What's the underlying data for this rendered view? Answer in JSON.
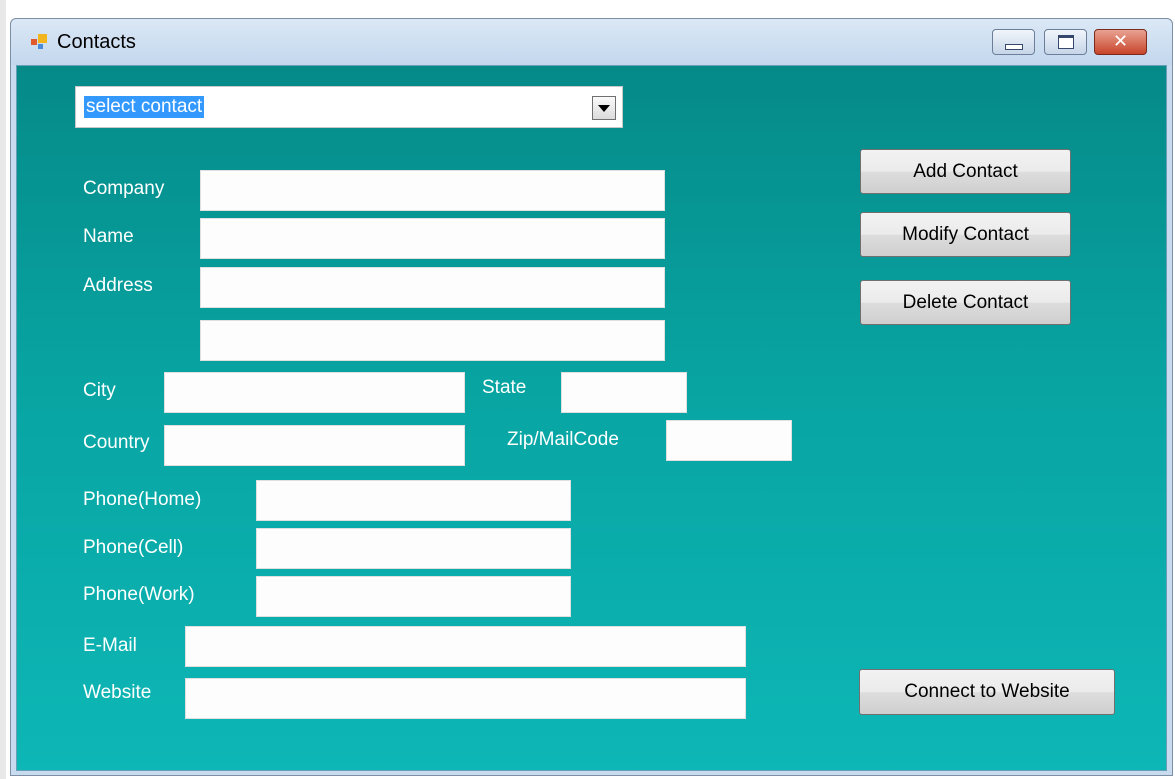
{
  "window": {
    "title": "Contacts"
  },
  "combo": {
    "value": "select contact"
  },
  "labels": {
    "company": "Company",
    "name": "Name",
    "address": "Address",
    "city": "City",
    "state": "State",
    "country": "Country",
    "zip": "Zip/MailCode",
    "phone_home": "Phone(Home)",
    "phone_cell": "Phone(Cell)",
    "phone_work": "Phone(Work)",
    "email": "E-Mail",
    "website": "Website"
  },
  "fields": {
    "company": "",
    "name": "",
    "address1": "",
    "address2": "",
    "city": "",
    "state": "",
    "country": "",
    "zip": "",
    "phone_home": "",
    "phone_cell": "",
    "phone_work": "",
    "email": "",
    "website": ""
  },
  "buttons": {
    "add": "Add Contact",
    "modify": "Modify Contact",
    "delete": "Delete Contact",
    "connect": "Connect to Website"
  },
  "icons": {
    "app": "app-window-icon",
    "minimize": "minimize-icon",
    "maximize": "maximize-icon",
    "close": "close-icon",
    "dropdown": "chevron-down-icon"
  },
  "colors": {
    "client_bg": "#08a4a2",
    "label": "#ffffff",
    "selection": "#3399ff"
  }
}
